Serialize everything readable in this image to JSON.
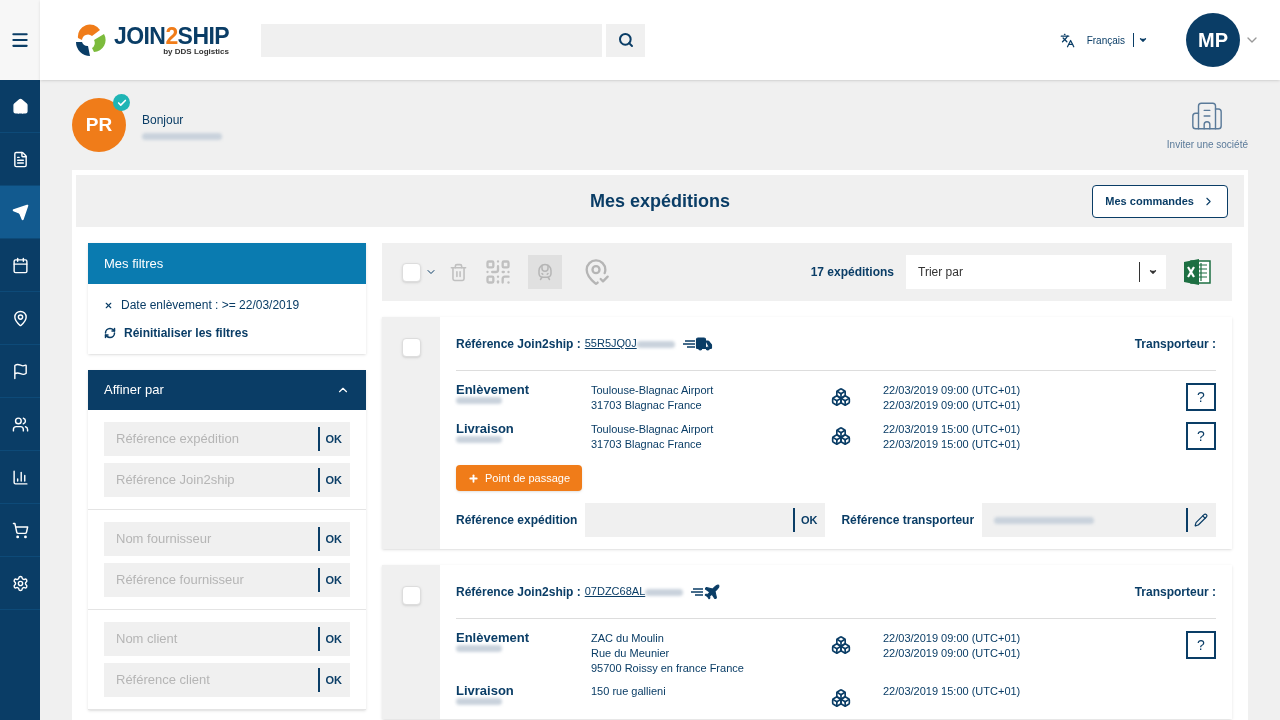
{
  "header": {
    "logo": {
      "main": "JOIN",
      "accent": "2",
      "rest": "SHIP",
      "tagline": "by DDS Logistics"
    },
    "language": "Français",
    "user_initials": "MP"
  },
  "sidebar": {
    "items": [
      {
        "kind": "home",
        "selected": false
      },
      {
        "kind": "document",
        "selected": false
      },
      {
        "kind": "send",
        "selected": true
      },
      {
        "kind": "calendar",
        "selected": false
      },
      {
        "kind": "pin",
        "selected": false
      },
      {
        "kind": "flag",
        "selected": false
      },
      {
        "kind": "users",
        "selected": false
      },
      {
        "kind": "chart",
        "selected": false
      },
      {
        "kind": "cart",
        "selected": false
      },
      {
        "kind": "settings",
        "selected": false
      }
    ]
  },
  "greeting": {
    "initials": "PR",
    "verified": true,
    "text": "Bonjour"
  },
  "invite": "Inviter une société",
  "page_title": "Mes expéditions",
  "orders_button": "Mes commandes",
  "active_filters": {
    "title": "Mes filtres",
    "filters": [
      "Date enlèvement : >= 22/03/2019"
    ],
    "reset": "Réinitialiser les filtres"
  },
  "refine": {
    "title": "Affiner par",
    "expanded": true,
    "groups": [
      [
        {
          "placeholder": "Référence expédition",
          "button": "OK"
        },
        {
          "placeholder": "Référence Join2ship",
          "button": "OK"
        }
      ],
      [
        {
          "placeholder": "Nom fournisseur",
          "button": "OK"
        },
        {
          "placeholder": "Référence fournisseur",
          "button": "OK"
        }
      ],
      [
        {
          "placeholder": "Nom client",
          "button": "OK"
        },
        {
          "placeholder": "Référence client",
          "button": "OK"
        }
      ]
    ]
  },
  "toolbar": {
    "select_all": false,
    "count": "17 expéditions",
    "sort_placeholder": "Trier par"
  },
  "shipments": [
    {
      "selected": false,
      "ref_label": "Référence Join2ship :",
      "ref": "55R5JQ0J",
      "kind": "truck",
      "carrier_label": "Transporteur :",
      "stops": [
        {
          "label": "Enlèvement",
          "address": [
            "Toulouse-Blagnac Airport",
            "31703 Blagnac France"
          ],
          "dates": [
            "22/03/2019 09:00 (UTC+01)",
            "22/03/2019 09:00 (UTC+01)"
          ],
          "appointment": "?"
        },
        {
          "label": "Livraison",
          "address": [
            "Toulouse-Blagnac Airport",
            "31703 Blagnac France"
          ],
          "dates": [
            "22/03/2019 15:00 (UTC+01)",
            "22/03/2019 15:00 (UTC+01)"
          ],
          "appointment": "?"
        }
      ],
      "waypoint_button": "Point de passage",
      "ship_ref_label": "Référence expédition",
      "ship_ref_button": "OK",
      "carrier_ref_label": "Référence transporteur"
    },
    {
      "selected": false,
      "ref_label": "Référence Join2ship :",
      "ref": "07DZC68AL",
      "kind": "plane",
      "carrier_label": "Transporteur :",
      "stops": [
        {
          "label": "Enlèvement",
          "address": [
            "ZAC du Moulin",
            "Rue du Meunier",
            "95700 Roissy en france France"
          ],
          "dates": [
            "22/03/2019 09:00 (UTC+01)",
            "22/03/2019 09:00 (UTC+01)"
          ],
          "appointment": "?"
        },
        {
          "label": "Livraison",
          "address": [
            "150 rue gallieni"
          ],
          "dates": [
            "22/03/2019 15:00 (UTC+01)"
          ]
        }
      ]
    }
  ]
}
